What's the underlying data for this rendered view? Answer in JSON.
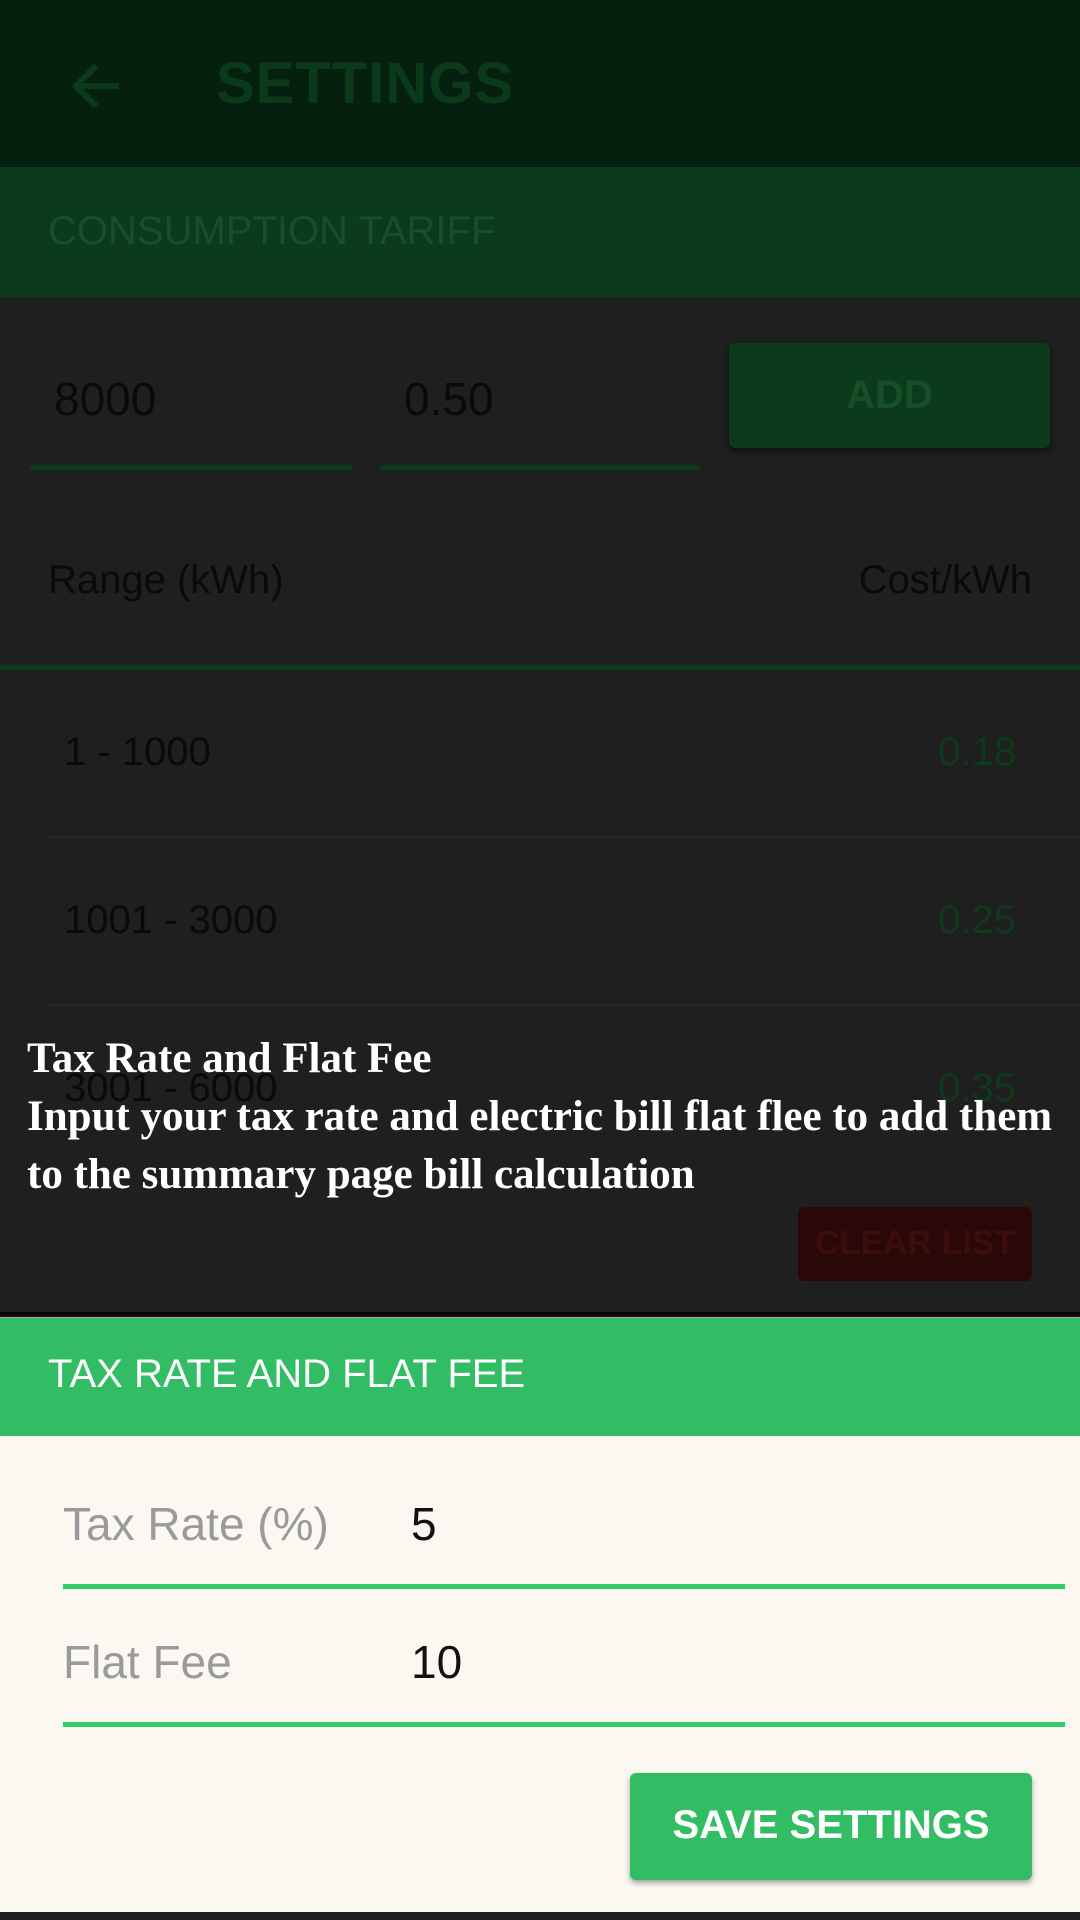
{
  "toolbar": {
    "back_icon": "arrow-left-icon",
    "title": "SETTINGS"
  },
  "consumption_tariff": {
    "header": "CONSUMPTION TARIFF",
    "range_input_value": "8000",
    "cost_input_value": "0.50",
    "add_label": "ADD",
    "column_range": "Range (kWh)",
    "column_cost": "Cost/kWh",
    "rows": [
      {
        "range": "1 - 1000",
        "cost": "0.18"
      },
      {
        "range": "1001 - 3000",
        "cost": "0.25"
      },
      {
        "range": "3001 - 6000",
        "cost": "0.35"
      }
    ],
    "clear_label": "CLEAR LIST"
  },
  "tutorial": {
    "title": "Tax Rate and Flat Fee",
    "description": "Input your tax rate and electric bill flat flee to add them to the summary page bill calculation"
  },
  "tax_card": {
    "header": "TAX RATE AND FLAT FEE",
    "tax_rate_label": "Tax Rate (%)",
    "tax_rate_value": "5",
    "flat_fee_label": "Flat Fee",
    "flat_fee_value": "10",
    "save_label": "SAVE SETTINGS"
  },
  "colors": {
    "accent": "#32bd65",
    "underline": "#2fcf6a",
    "card_background": "#fbf8f2",
    "dim_overlay": "#1f1f1f"
  }
}
